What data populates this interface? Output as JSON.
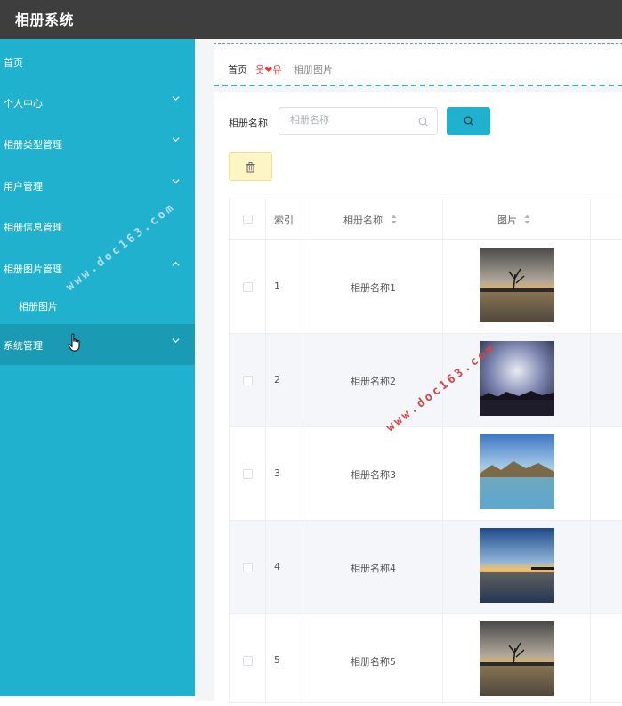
{
  "app": {
    "title": "相册系统"
  },
  "sidebar": {
    "items": [
      {
        "label": "首页"
      },
      {
        "label": "个人中心"
      },
      {
        "label": "相册类型管理"
      },
      {
        "label": "用户管理"
      },
      {
        "label": "相册信息管理"
      },
      {
        "label": "相册图片管理"
      },
      {
        "label": "相册图片"
      },
      {
        "label": "系统管理"
      }
    ]
  },
  "breadcrumb": {
    "home": "首页",
    "separator": "웃❤유",
    "current": "相册图片"
  },
  "search": {
    "label": "相册名称",
    "placeholder": "相册名称",
    "value": ""
  },
  "table": {
    "headers": {
      "index": "索引",
      "name": "相册名称",
      "picture": "图片"
    },
    "rows": [
      {
        "index": "1",
        "name": "相册名称1"
      },
      {
        "index": "2",
        "name": "相册名称2"
      },
      {
        "index": "3",
        "name": "相册名称3"
      },
      {
        "index": "4",
        "name": "相册名称4"
      },
      {
        "index": "5",
        "name": "相册名称5"
      }
    ]
  },
  "watermark": {
    "text": "www.doc163.com"
  },
  "colors": {
    "topbar": "#3e3e3e",
    "sidebar": "#1fb1cd",
    "sidebar_active": "#1a9ab3",
    "accent": "#1fb1cd",
    "delete_bg": "#fdf5c4"
  },
  "icons": [
    "chevron-down-icon",
    "chevron-up-icon",
    "search-icon",
    "trash-icon",
    "sort-icon",
    "hand-cursor-icon"
  ]
}
